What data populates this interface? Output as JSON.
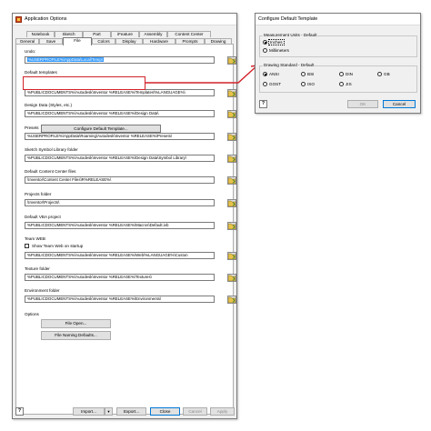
{
  "main_window": {
    "title": "Application Options",
    "tabs_row1": [
      "Notebook",
      "Sketch",
      "Part",
      "iFeature",
      "Assembly",
      "Content Center"
    ],
    "tabs_row2": [
      "General",
      "Save",
      "File",
      "Colors",
      "Display",
      "Hardware",
      "Prompts",
      "Drawing"
    ],
    "active_tab": "File",
    "undo": {
      "label": "Undo:",
      "value": "%USERPROFILE%\\AppData\\Local\\Temp\\"
    },
    "default_templates": {
      "label": "Default templates",
      "button": "Configure Default Template...",
      "value": "%PUBLICDOCUMENTS%\\Autodesk\\Inventor %RELEASE%\\Templates\\%LANGUAGE%\\"
    },
    "design_data": {
      "label": "Design Data (Styles, etc.)",
      "value": "%PUBLICDOCUMENTS%\\Autodesk\\Inventor %RELEASE%\\Design Data\\"
    },
    "presets": {
      "label": "Presets",
      "value": "%USERPROFILE%\\AppData\\Roaming\\Autodesk\\Inventor %RELEASE%\\Presets\\"
    },
    "sketch_symbol": {
      "label": "Sketch Symbol Library folder",
      "value": "%PUBLICDOCUMENTS%\\Autodesk\\Inventor %RELEASE%\\Design Data\\Symbol Library\\"
    },
    "content_center": {
      "label": "Default Content Center files",
      "value": "\\Inventor\\Content Center Files\\R%RELEASE%\\"
    },
    "projects": {
      "label": "Projects folder",
      "value": "\\Inventor\\Projects\\"
    },
    "vba": {
      "label": "Default VBA project",
      "value": "%PUBLICDOCUMENTS%\\Autodesk\\Inventor %RELEASE%\\Macros\\Default.ivb"
    },
    "team_web": {
      "label": "Team WEB",
      "checkbox_label": "Show Team Web on startup",
      "value": "%PUBLICDOCUMENTS%\\Autodesk\\Inventor %RELEASE%\\Web\\%LANGUAGE%\\Custon"
    },
    "texture": {
      "label": "Texture folder",
      "value": "%PUBLICDOCUMENTS%\\Autodesk\\Inventor %RELEASE%\\Textures\\"
    },
    "environment": {
      "label": "Environment folder",
      "value": "%PUBLICDOCUMENTS%\\Autodesk\\Inventor %RELEASE%\\Environments\\"
    },
    "options": {
      "label": "Options",
      "file_open": "File Open...",
      "file_naming": "File Naming Defaults..."
    },
    "footer": {
      "help": "?",
      "import": "Import...",
      "export": "Export...",
      "close": "Close",
      "cancel": "Cancel",
      "apply": "Apply"
    }
  },
  "cfg_dialog": {
    "title": "Configure Default Template",
    "units": {
      "label": "Measurement Units - Default",
      "options": [
        "Inches",
        "Millimeters"
      ],
      "selected": "Inches"
    },
    "standard": {
      "label": "Drawing Standard - Default",
      "options": [
        "ANSI",
        "BSI",
        "DIN",
        "GB",
        "GOST",
        "ISO",
        "JIS"
      ],
      "selected": "ANSI"
    },
    "footer": {
      "help": "?",
      "ok": "OK",
      "cancel": "Cancel"
    }
  },
  "colors": {
    "accent": "#3399ff",
    "highlight": "#d2232a",
    "window_bg": "#f0f0f0"
  }
}
